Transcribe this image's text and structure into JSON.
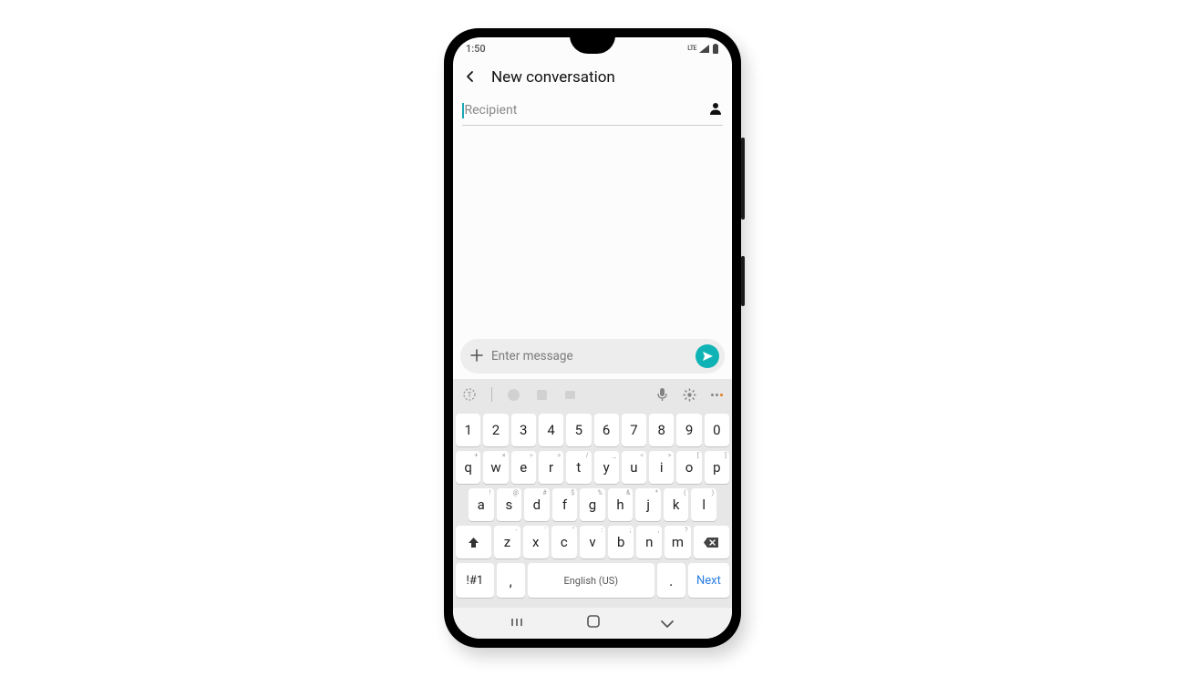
{
  "status": {
    "time": "1:50",
    "lte": "LTE"
  },
  "header": {
    "title": "New conversation"
  },
  "recipient": {
    "placeholder": "Recipient"
  },
  "compose": {
    "placeholder": "Enter message"
  },
  "keyboard": {
    "row_num": [
      "1",
      "2",
      "3",
      "4",
      "5",
      "6",
      "7",
      "8",
      "9",
      "0"
    ],
    "row1": [
      {
        "k": "q",
        "s": "+"
      },
      {
        "k": "w",
        "s": "×"
      },
      {
        "k": "e",
        "s": "÷"
      },
      {
        "k": "r",
        "s": "="
      },
      {
        "k": "t",
        "s": "/"
      },
      {
        "k": "y",
        "s": "_"
      },
      {
        "k": "u",
        "s": "<"
      },
      {
        "k": "i",
        "s": ">"
      },
      {
        "k": "o",
        "s": "["
      },
      {
        "k": "p",
        "s": "]"
      }
    ],
    "row2": [
      {
        "k": "a",
        "s": "!"
      },
      {
        "k": "s",
        "s": "@"
      },
      {
        "k": "d",
        "s": "#"
      },
      {
        "k": "f",
        "s": "$"
      },
      {
        "k": "g",
        "s": "%"
      },
      {
        "k": "h",
        "s": "&"
      },
      {
        "k": "j",
        "s": "*"
      },
      {
        "k": "k",
        "s": "("
      },
      {
        "k": "l",
        "s": ")"
      }
    ],
    "row3": [
      {
        "k": "z",
        "s": "-"
      },
      {
        "k": "x",
        "s": "'"
      },
      {
        "k": "c",
        "s": "\""
      },
      {
        "k": "v",
        "s": ":"
      },
      {
        "k": "b",
        "s": ";"
      },
      {
        "k": "n",
        "s": ","
      },
      {
        "k": "m",
        "s": "?"
      }
    ],
    "sym": "!#1",
    "comma": ",",
    "space": "English (US)",
    "period": ".",
    "next": "Next"
  }
}
